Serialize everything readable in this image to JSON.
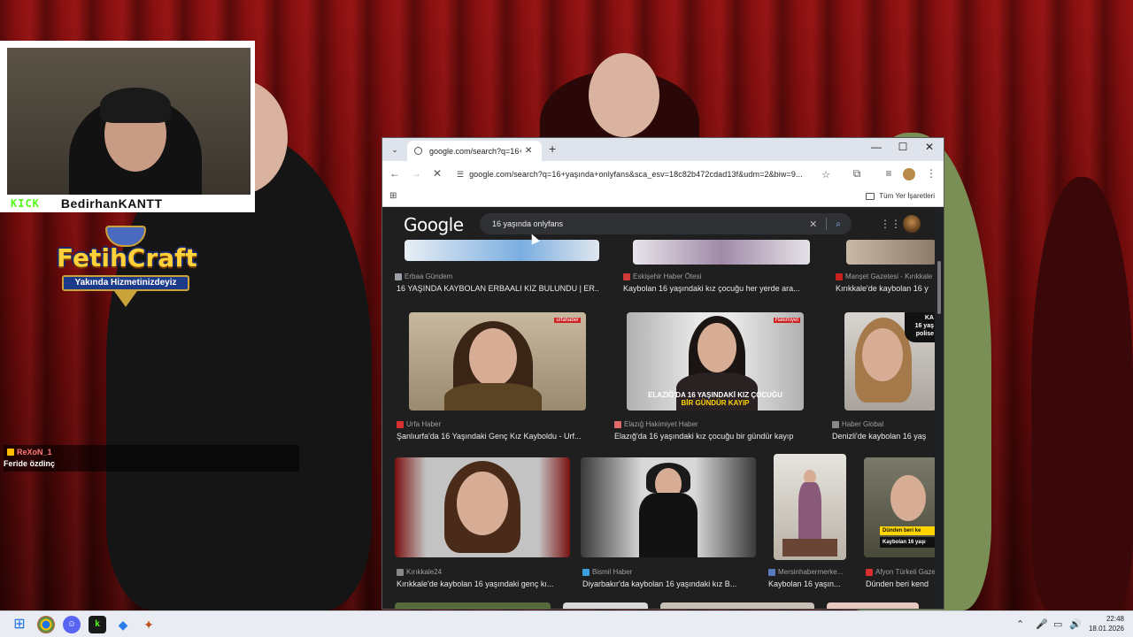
{
  "stream": {
    "platform_logo": "KICK",
    "streamer_name": "BedirhanKANTT",
    "server_logo": {
      "title": "FetihCraft",
      "tagline": "Yakında Hizmetinizdeyiz"
    },
    "chat": {
      "username": "ReXoN_1",
      "message": "Feride özdinç"
    }
  },
  "browser": {
    "tab": {
      "title": "google.com/search?q=16+yaşında",
      "favicon": "globe-icon"
    },
    "url": "google.com/search?q=16+yaşında+onlyfans&sca_esv=18c82b472cdad13f&udm=2&biw=9...",
    "bookmarks_label": "Tüm Yer İşaretleri",
    "window_controls": {
      "minimize": "—",
      "maximize": "☐",
      "close": "✕"
    }
  },
  "google": {
    "logo": "Google",
    "query": "16 yaşında onlyfans",
    "rows": [
      {
        "items": [
          {
            "source": "Erbaa Gündem",
            "title": "16 YAŞINDA KAYBOLAN ERBAALI KIZ BULUNDU | ER..."
          },
          {
            "source": "Eskişehir Haber Ötesi",
            "title": "Kaybolan 16 yaşındaki kız çocuğu her yerde ara..."
          },
          {
            "source": "Manşet Gazetesi - Kırıkkale",
            "title": "Kırıkkale'de kaybolan 16 y"
          }
        ]
      },
      {
        "items": [
          {
            "source": "Urfa Haber",
            "title": "Şanlıurfa'da 16 Yaşındaki Genç Kız Kayboldu - Urf...",
            "badge": "urfahaber"
          },
          {
            "source": "Elazığ Hakimiyet Haber",
            "title": "Elazığ'da 16 yaşındaki kız çocuğu bir gündür kayıp",
            "badge": "Hakimiyet",
            "caption_1": "ELAZIĞ'DA 16 YAŞINDAKİ KIZ ÇOCUĞU",
            "caption_2": "BİR GÜNDÜR KAYIP"
          },
          {
            "source": "Haber Global",
            "title": "Denizli'de kaybolan 16 yaş",
            "caption_1": "KA",
            "caption_2": "16 yaş",
            "caption_3": "polise"
          }
        ]
      },
      {
        "items": [
          {
            "source": "Kırıkkale24",
            "title": "Kırıkkale'de kaybolan 16 yaşındaki genç kı..."
          },
          {
            "source": "Bismil Haber",
            "title": "Diyarbakır'da kaybolan 16 yaşındaki kız B..."
          },
          {
            "source": "Mersinhabermerke...",
            "title": "Kaybolan 16 yaşın..."
          },
          {
            "source": "Afyon Türkeli Gaze",
            "title": "Dünden beri kend",
            "caption_1": "Dünden beri ke",
            "caption_2": "Kaybolan 16 yaşı"
          }
        ]
      }
    ]
  },
  "taskbar": {
    "time": "22:48",
    "date": "18.01.2026"
  },
  "colors": {
    "kick_green": "#53fc18",
    "google_dark_bg": "#1f1f1f",
    "search_box": "#303134",
    "caption_yellow": "#ffd400"
  }
}
